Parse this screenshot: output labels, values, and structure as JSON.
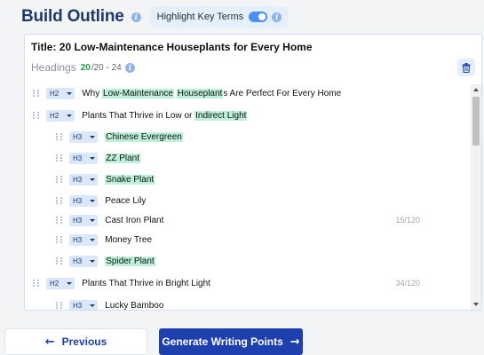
{
  "header": {
    "title": "Build Outline",
    "highlight_label": "Highlight Key Terms",
    "highlight_on": true
  },
  "panel": {
    "title": "Title: 20 Low-Maintenance Houseplants for Every Home",
    "headings_label": "Headings",
    "headings_count": "20",
    "headings_range": "/20 - 24"
  },
  "rows": [
    {
      "level": "H2",
      "indent": 0,
      "segments": [
        [
          "Why ",
          false
        ],
        [
          "Low-Maintenance",
          true
        ],
        [
          " ",
          false
        ],
        [
          "Houseplant",
          true
        ],
        [
          "s Are Perfect For Every Home",
          false
        ]
      ],
      "counter": ""
    },
    {
      "level": "H2",
      "indent": 0,
      "segments": [
        [
          "Plants That Thrive in Low or ",
          false
        ],
        [
          "Indirect Light",
          true
        ]
      ],
      "counter": ""
    },
    {
      "level": "H3",
      "indent": 1,
      "segments": [
        [
          "Chinese Evergreen",
          true
        ]
      ],
      "counter": ""
    },
    {
      "level": "H3",
      "indent": 1,
      "segments": [
        [
          "ZZ Plant",
          true
        ]
      ],
      "counter": ""
    },
    {
      "level": "H3",
      "indent": 1,
      "segments": [
        [
          "Snake Plant",
          true
        ]
      ],
      "counter": ""
    },
    {
      "level": "H3",
      "indent": 1,
      "segments": [
        [
          "Peace Lily",
          false
        ]
      ],
      "counter": ""
    },
    {
      "level": "H3",
      "indent": 1,
      "segments": [
        [
          "Cast Iron Plant",
          false
        ]
      ],
      "counter": "15/120"
    },
    {
      "level": "H3",
      "indent": 1,
      "segments": [
        [
          "Money Tree",
          false
        ]
      ],
      "counter": ""
    },
    {
      "level": "H3",
      "indent": 1,
      "segments": [
        [
          "Spider Plant",
          true
        ]
      ],
      "counter": ""
    },
    {
      "level": "H2",
      "indent": 0,
      "segments": [
        [
          "Plants That Thrive in Bright Light",
          false
        ]
      ],
      "counter": "34/120"
    },
    {
      "level": "H3",
      "indent": 1,
      "segments": [
        [
          "Lucky Bamboo",
          false
        ]
      ],
      "counter": ""
    }
  ],
  "buttons": {
    "previous": "Previous",
    "generate": "Generate Writing Points"
  },
  "colors": {
    "primary": "#1e40af",
    "highlight": "#bdf0d9",
    "tag_bg": "#dbe8fb"
  },
  "icons": {
    "info": "info-icon",
    "trash": "trash-icon",
    "drag": "drag-handle-icon",
    "caret": "chevron-down-icon",
    "arrow_left": "arrow-left-icon",
    "arrow_right": "arrow-right-icon"
  }
}
